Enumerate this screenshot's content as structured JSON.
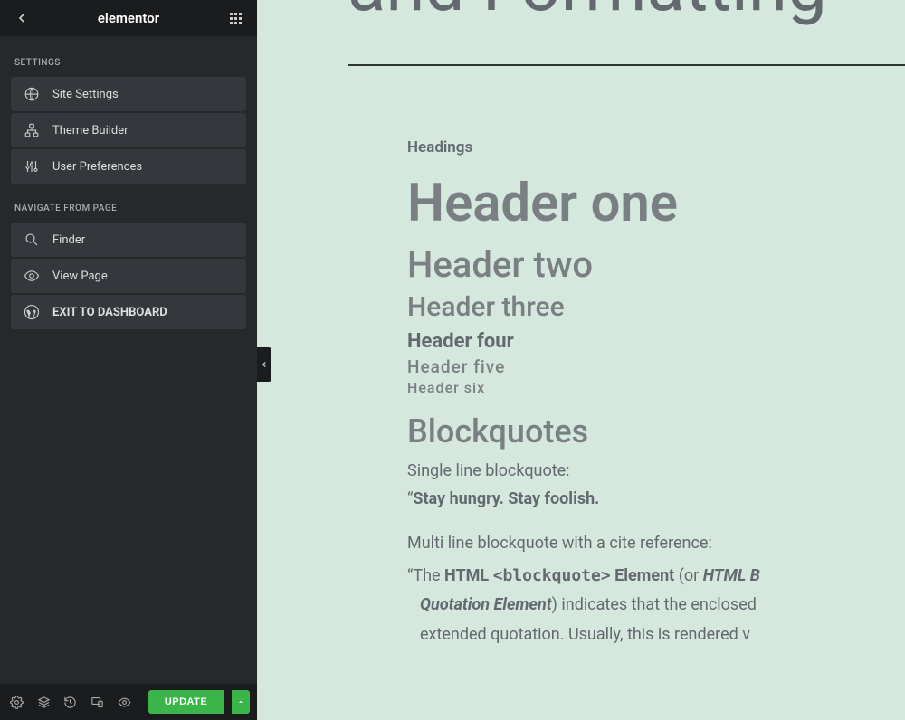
{
  "header": {
    "logo": "elementor"
  },
  "sections": {
    "settings": {
      "label": "SETTINGS",
      "items": [
        {
          "label": "Site Settings"
        },
        {
          "label": "Theme Builder"
        },
        {
          "label": "User Preferences"
        }
      ]
    },
    "navigate": {
      "label": "NAVIGATE FROM PAGE",
      "items": [
        {
          "label": "Finder"
        },
        {
          "label": "View Page"
        },
        {
          "label": "EXIT TO DASHBOARD"
        }
      ]
    }
  },
  "footer": {
    "update": "UPDATE"
  },
  "canvas": {
    "title": "and Formatting",
    "headings_label": "Headings",
    "h1": "Header one",
    "h2": "Header two",
    "h3": "Header three",
    "h4": "Header four",
    "h5": "Header five",
    "h6": "Header six",
    "blockquotes_heading": "Blockquotes",
    "single_label": "Single line blockquote:",
    "single_quote": "Stay hungry. Stay foolish.",
    "multi_label": "Multi line blockquote with a cite reference:",
    "multi_quote": {
      "t1": "The ",
      "t2": "HTML ",
      "code": "<blockquote>",
      "t3": " Element",
      "t4": " (or ",
      "em": "HTML B",
      "line2_em": "Quotation Element",
      "line2_a": ") indicates that the enclosed",
      "line3": "extended quotation. Usually, this is rendered v"
    }
  }
}
